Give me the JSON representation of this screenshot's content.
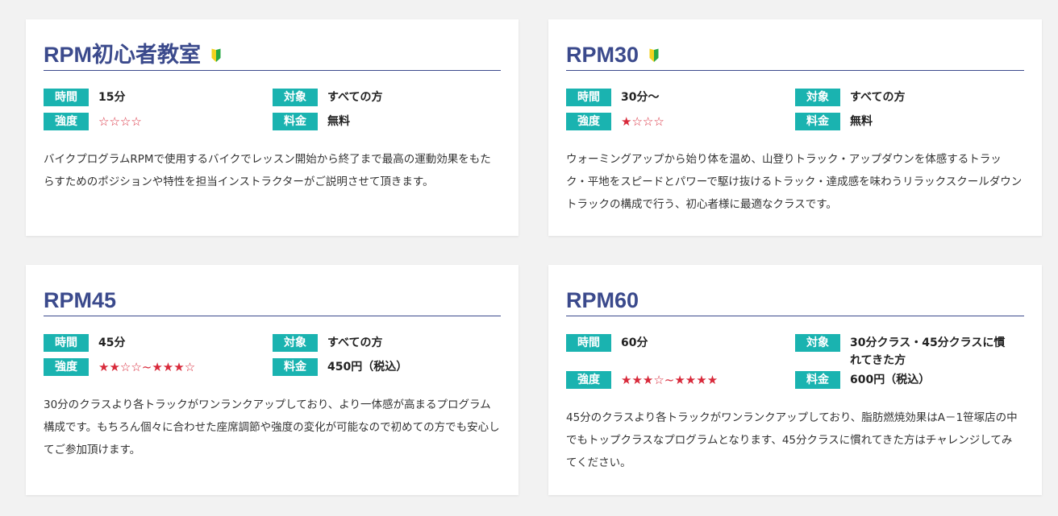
{
  "labels": {
    "time": "時間",
    "intensity": "強度",
    "target": "対象",
    "fee": "料金"
  },
  "colors": {
    "title": "#3b4a8c",
    "tag_bg": "#1ab3b0",
    "star": "#d8293a",
    "page_bg": "#f2f2f2"
  },
  "cards": [
    {
      "title": "RPM初心者教室",
      "beginner_icon": "beginner-leaf-icon",
      "time": "15分",
      "target": "すべての方",
      "stars": "☆☆☆☆",
      "fee": "無料",
      "description": "バイクプログラムRPMで使用するバイクでレッスン開始から終了まで最高の運動効果をもたらすためのポジションや特性を担当インストラクターがご説明させて頂きます。"
    },
    {
      "title": "RPM30",
      "beginner_icon": "beginner-leaf-icon",
      "time": "30分～",
      "target": "すべての方",
      "stars": "★☆☆☆",
      "fee": "無料",
      "description": "ウォーミングアップから始り体を温め、山登りトラック・アップダウンを体感するトラック・平地をスピードとパワーで駆け抜けるトラック・達成感を味わうリラックスクールダウントラックの構成で行う、初心者様に最適なクラスです。"
    },
    {
      "title": "RPM45",
      "time": "45分",
      "target": "すべての方",
      "stars": "★★☆☆~★★★☆",
      "fee": "450円（税込）",
      "description": "30分のクラスより各トラックがワンランクアップしており、より一体感が高まるプログラム構成です。もちろん個々に合わせた座席調節や強度の変化が可能なので初めての方でも安心してご参加頂けます。"
    },
    {
      "title": "RPM60",
      "time": "60分",
      "target": "30分クラス・45分クラスに慣れてきた方",
      "stars": "★★★☆~★★★★",
      "fee": "600円（税込）",
      "description": "45分のクラスより各トラックがワンランクアップしており、脂肪燃焼効果はA－1笹塚店の中でもトップクラスなプログラムとなります、45分クラスに慣れてきた方はチャレンジしてみてください。"
    }
  ]
}
